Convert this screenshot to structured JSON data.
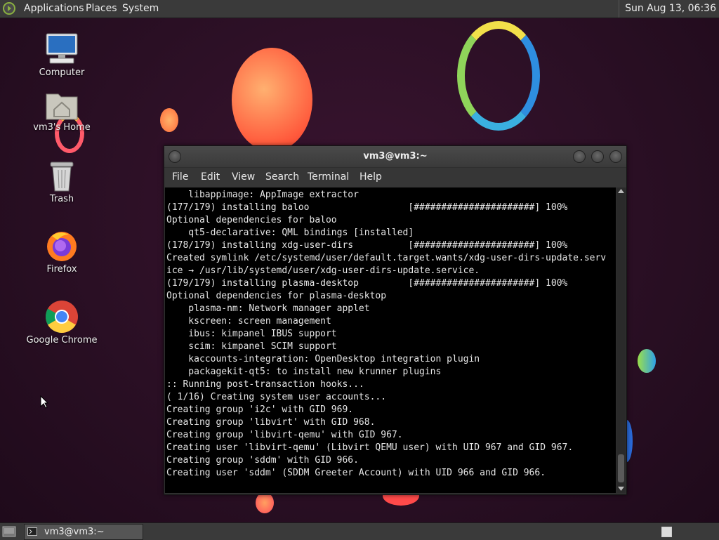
{
  "top_panel": {
    "menus": [
      "Applications",
      "Places",
      "System"
    ],
    "clock": "Sun Aug 13, 06:36"
  },
  "desktop": {
    "icons": [
      {
        "label": "Computer",
        "icon": "computer-icon"
      },
      {
        "label": "vm3's Home",
        "icon": "home-folder-icon"
      },
      {
        "label": "Trash",
        "icon": "trash-icon"
      },
      {
        "label": "Firefox",
        "icon": "firefox-icon"
      },
      {
        "label": "Google Chrome",
        "icon": "chrome-icon"
      }
    ]
  },
  "terminal": {
    "title": "vm3@vm3:~",
    "menu": [
      "File",
      "Edit",
      "View",
      "Search",
      "Terminal",
      "Help"
    ],
    "lines": [
      "    libappimage: AppImage extractor",
      "(177/179) installing baloo                  [######################] 100%",
      "Optional dependencies for baloo",
      "    qt5-declarative: QML bindings [installed]",
      "(178/179) installing xdg-user-dirs          [######################] 100%",
      "Created symlink /etc/systemd/user/default.target.wants/xdg-user-dirs-update.serv",
      "ice → /usr/lib/systemd/user/xdg-user-dirs-update.service.",
      "(179/179) installing plasma-desktop         [######################] 100%",
      "Optional dependencies for plasma-desktop",
      "    plasma-nm: Network manager applet",
      "    kscreen: screen management",
      "    ibus: kimpanel IBUS support",
      "    scim: kimpanel SCIM support",
      "    kaccounts-integration: OpenDesktop integration plugin",
      "    packagekit-qt5: to install new krunner plugins",
      ":: Running post-transaction hooks...",
      "( 1/16) Creating system user accounts...",
      "Creating group 'i2c' with GID 969.",
      "Creating group 'libvirt' with GID 968.",
      "Creating group 'libvirt-qemu' with GID 967.",
      "Creating user 'libvirt-qemu' (Libvirt QEMU user) with UID 967 and GID 967.",
      "Creating group 'sddm' with GID 966.",
      "Creating user 'sddm' (SDDM Greeter Account) with UID 966 and GID 966."
    ]
  },
  "taskbar": {
    "tasks": [
      {
        "label": "vm3@vm3:~",
        "icon": "terminal-icon"
      }
    ]
  }
}
